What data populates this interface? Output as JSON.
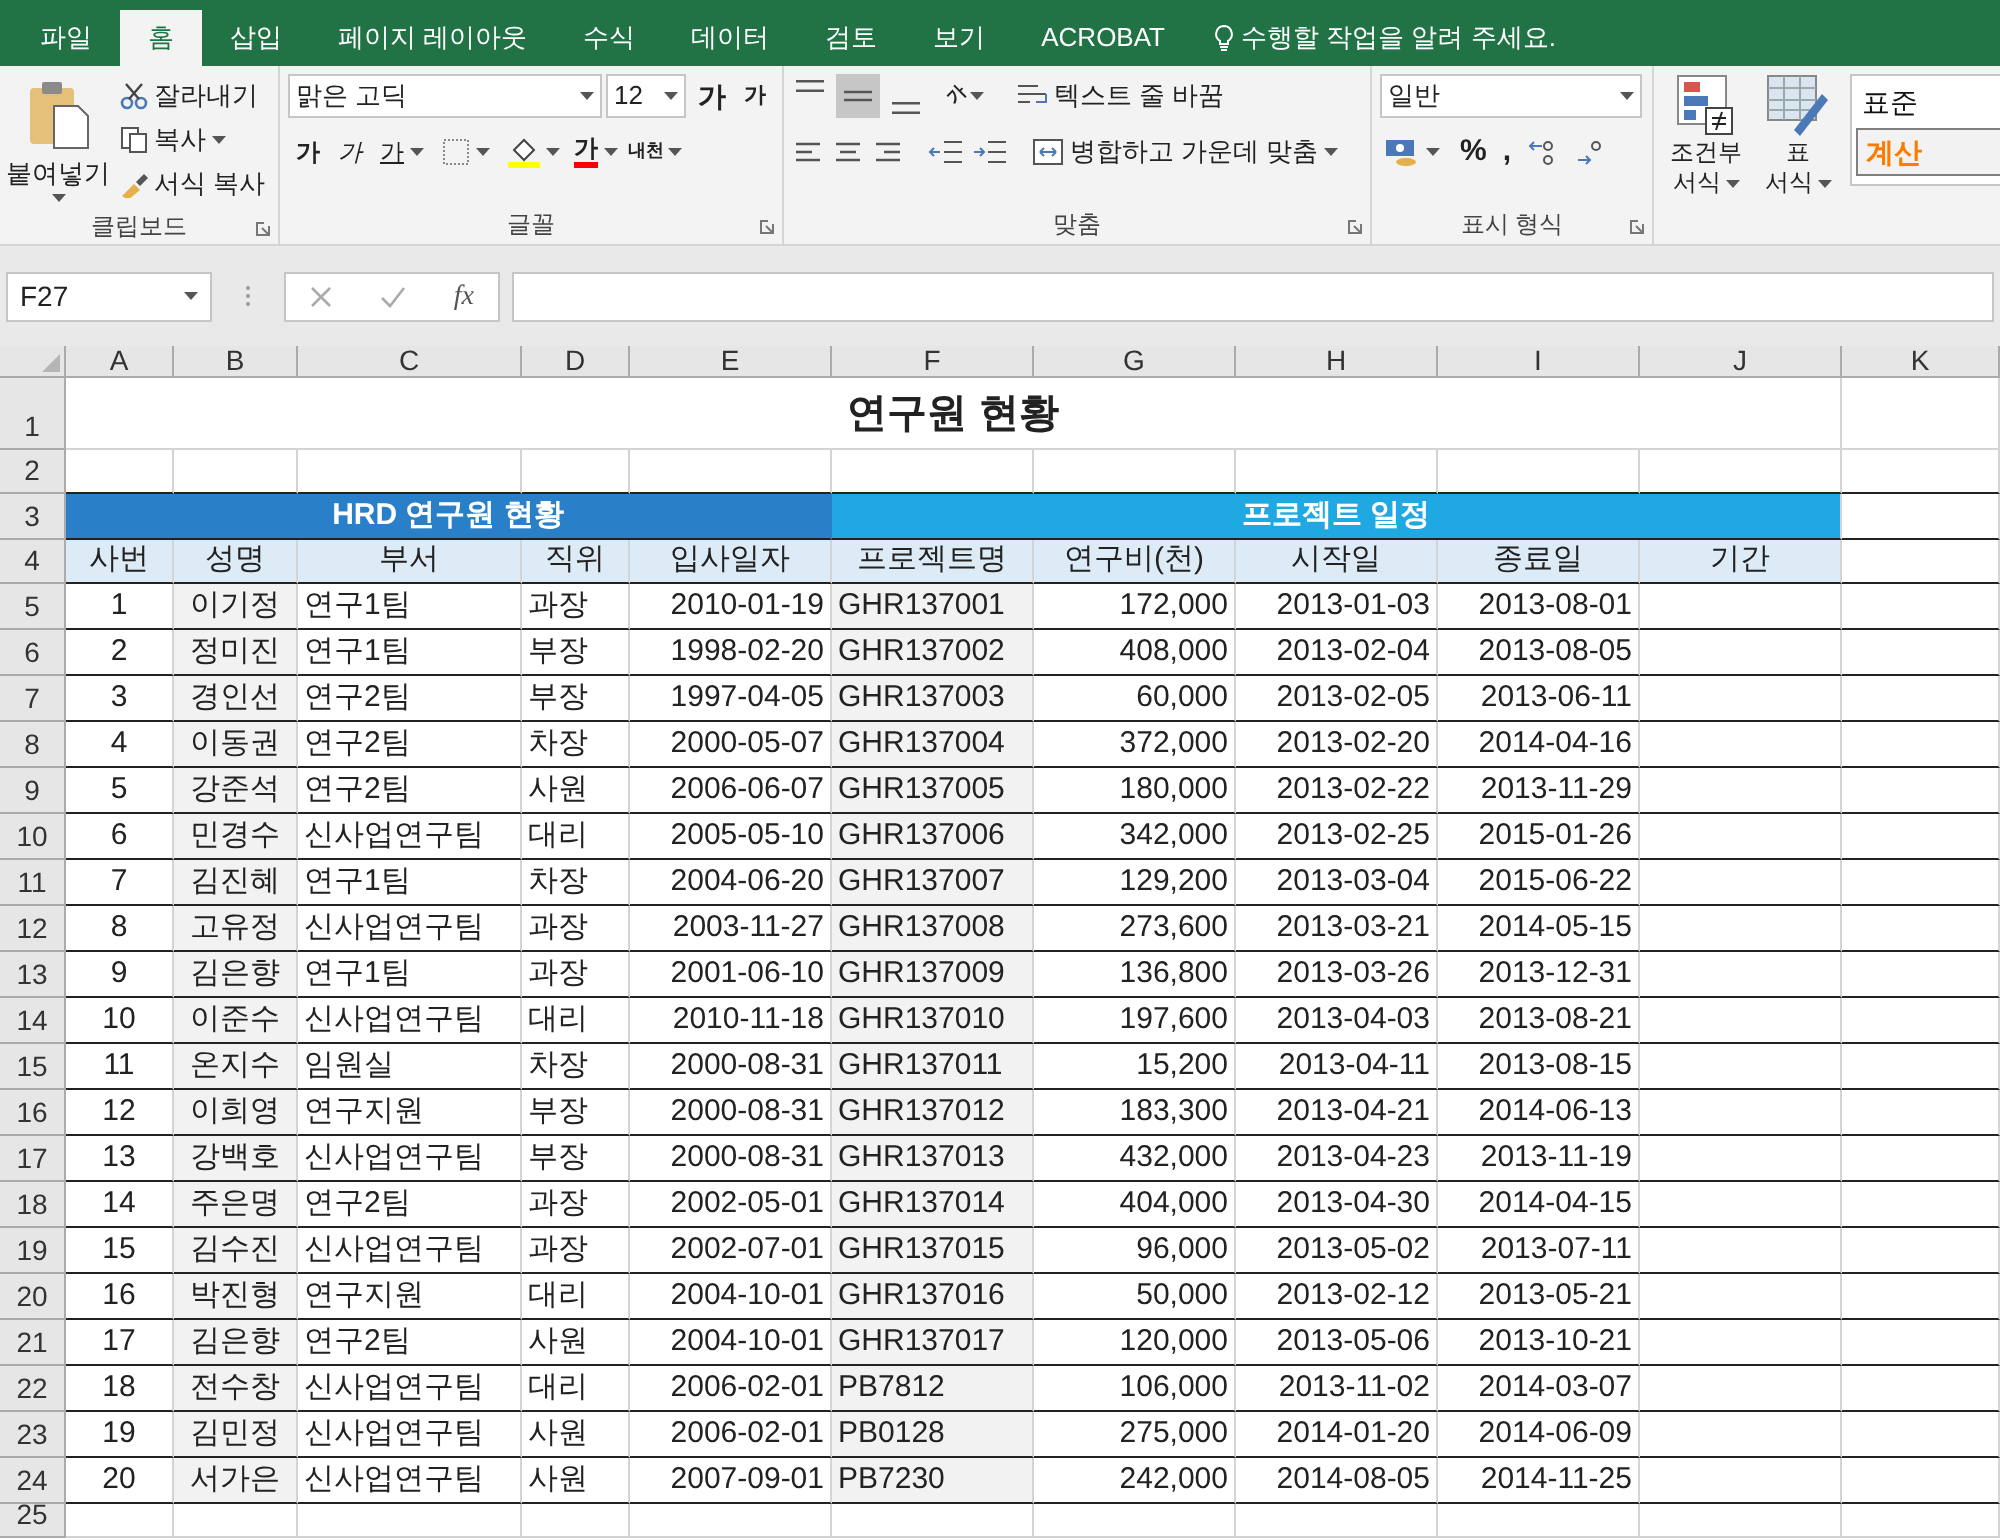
{
  "ribbon_tabs": [
    {
      "label": "파일",
      "selected": false
    },
    {
      "label": "홈",
      "selected": true
    },
    {
      "label": "삽입",
      "selected": false
    },
    {
      "label": "페이지 레이아웃",
      "selected": false
    },
    {
      "label": "수식",
      "selected": false
    },
    {
      "label": "데이터",
      "selected": false
    },
    {
      "label": "검토",
      "selected": false
    },
    {
      "label": "보기",
      "selected": false
    },
    {
      "label": "ACROBAT",
      "selected": false
    }
  ],
  "tell_me": "수행할 작업을 알려 주세요.",
  "clipboard": {
    "paste": "붙여넣기",
    "cut": "잘라내기",
    "copy": "복사",
    "format_painter": "서식 복사",
    "label": "클립보드"
  },
  "font": {
    "name": "맑은 고딕",
    "size": "12",
    "grow": "가",
    "shrink": "가",
    "bold": "가",
    "italic": "가",
    "underline": "가",
    "font_color": "가",
    "phonetic": "내천",
    "label": "글꼴"
  },
  "alignment": {
    "orientation": "가",
    "wrap_text": "텍스트 줄 바꿈",
    "merge_center": "병합하고 가운데 맞춤",
    "label": "맞춤"
  },
  "number": {
    "format": "일반",
    "percent": "%",
    "comma": ",",
    "label": "표시 형식"
  },
  "styles": {
    "conditional": [
      "조건부",
      "서식"
    ],
    "table": [
      "표",
      "서식"
    ],
    "cells": [
      {
        "label": "표준",
        "kind": "normal"
      },
      {
        "label": "계산",
        "kind": "calculation"
      }
    ]
  },
  "formula_bar": {
    "name_box": "F27",
    "fx": "fx"
  },
  "columns": [
    "A",
    "B",
    "C",
    "D",
    "E",
    "F",
    "G",
    "H",
    "I",
    "J",
    "K"
  ],
  "row_numbers": [
    "1",
    "2",
    "3",
    "4",
    "5",
    "6",
    "7",
    "8",
    "9",
    "10",
    "11",
    "12",
    "13",
    "14",
    "15",
    "16",
    "17",
    "18",
    "19",
    "20",
    "21",
    "22",
    "23",
    "24",
    "25"
  ],
  "sheet": {
    "title": "연구원 현황",
    "group_headers": [
      "HRD 연구원 현황",
      "프로젝트 일정"
    ],
    "headers": [
      "사번",
      "성명",
      "부서",
      "직위",
      "입사일자",
      "프로젝트명",
      "연구비(천)",
      "시작일",
      "종료일",
      "기간"
    ],
    "rows": [
      [
        "1",
        "이기정",
        "연구1팀",
        "과장",
        "2010-01-19",
        "GHR137001",
        "172,000",
        "2013-01-03",
        "2013-08-01"
      ],
      [
        "2",
        "정미진",
        "연구1팀",
        "부장",
        "1998-02-20",
        "GHR137002",
        "408,000",
        "2013-02-04",
        "2013-08-05"
      ],
      [
        "3",
        "경인선",
        "연구2팀",
        "부장",
        "1997-04-05",
        "GHR137003",
        "60,000",
        "2013-02-05",
        "2013-06-11"
      ],
      [
        "4",
        "이동권",
        "연구2팀",
        "차장",
        "2000-05-07",
        "GHR137004",
        "372,000",
        "2013-02-20",
        "2014-04-16"
      ],
      [
        "5",
        "강준석",
        "연구2팀",
        "사원",
        "2006-06-07",
        "GHR137005",
        "180,000",
        "2013-02-22",
        "2013-11-29"
      ],
      [
        "6",
        "민경수",
        "신사업연구팀",
        "대리",
        "2005-05-10",
        "GHR137006",
        "342,000",
        "2013-02-25",
        "2015-01-26"
      ],
      [
        "7",
        "김진혜",
        "연구1팀",
        "차장",
        "2004-06-20",
        "GHR137007",
        "129,200",
        "2013-03-04",
        "2015-06-22"
      ],
      [
        "8",
        "고유정",
        "신사업연구팀",
        "과장",
        "2003-11-27",
        "GHR137008",
        "273,600",
        "2013-03-21",
        "2014-05-15"
      ],
      [
        "9",
        "김은향",
        "연구1팀",
        "과장",
        "2001-06-10",
        "GHR137009",
        "136,800",
        "2013-03-26",
        "2013-12-31"
      ],
      [
        "10",
        "이준수",
        "신사업연구팀",
        "대리",
        "2010-11-18",
        "GHR137010",
        "197,600",
        "2013-04-03",
        "2013-08-21"
      ],
      [
        "11",
        "온지수",
        "임원실",
        "차장",
        "2000-08-31",
        "GHR137011",
        "15,200",
        "2013-04-11",
        "2013-08-15"
      ],
      [
        "12",
        "이희영",
        "연구지원",
        "부장",
        "2000-08-31",
        "GHR137012",
        "183,300",
        "2013-04-21",
        "2014-06-13"
      ],
      [
        "13",
        "강백호",
        "신사업연구팀",
        "부장",
        "2000-08-31",
        "GHR137013",
        "432,000",
        "2013-04-23",
        "2013-11-19"
      ],
      [
        "14",
        "주은명",
        "연구2팀",
        "과장",
        "2002-05-01",
        "GHR137014",
        "404,000",
        "2013-04-30",
        "2014-04-15"
      ],
      [
        "15",
        "김수진",
        "신사업연구팀",
        "과장",
        "2002-07-01",
        "GHR137015",
        "96,000",
        "2013-05-02",
        "2013-07-11"
      ],
      [
        "16",
        "박진형",
        "연구지원",
        "대리",
        "2004-10-01",
        "GHR137016",
        "50,000",
        "2013-02-12",
        "2013-05-21"
      ],
      [
        "17",
        "김은향",
        "연구2팀",
        "사원",
        "2004-10-01",
        "GHR137017",
        "120,000",
        "2013-05-06",
        "2013-10-21"
      ],
      [
        "18",
        "전수창",
        "신사업연구팀",
        "대리",
        "2006-02-01",
        "PB7812",
        "106,000",
        "2013-11-02",
        "2014-03-07"
      ],
      [
        "19",
        "김민정",
        "신사업연구팀",
        "사원",
        "2006-02-01",
        "PB0128",
        "275,000",
        "2014-01-20",
        "2014-06-09"
      ],
      [
        "20",
        "서가은",
        "신사업연구팀",
        "사원",
        "2007-09-01",
        "PB7230",
        "242,000",
        "2014-08-05",
        "2014-11-25"
      ]
    ]
  }
}
